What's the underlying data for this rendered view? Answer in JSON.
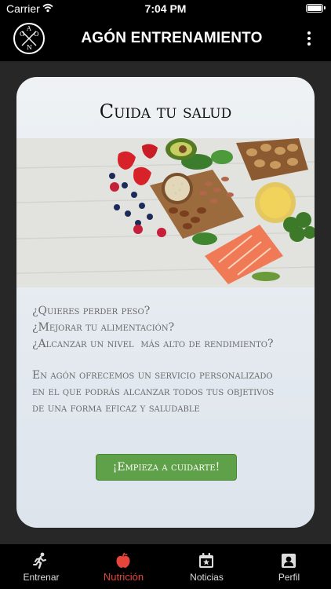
{
  "status_bar": {
    "carrier": "Carrier",
    "time": "7:04 PM"
  },
  "nav": {
    "logo_letters": [
      "G",
      "A",
      "O",
      "N"
    ],
    "title": "AGÓN ENTRENAMIENTO",
    "menu_icon": "more-vertical-icon"
  },
  "card": {
    "title": "Cuida tu salud",
    "image": "healthy-food-photo",
    "questions": [
      "¿Quieres perder peso?",
      "¿Mejorar tu alimentación?",
      "¿Alcanzar un nivel  más alto de rendimiento?"
    ],
    "offer": [
      "En agón ofrecemos un servicio personalizado",
      "en el que podrás alcanzar todos tus objetivos",
      "de una forma eficaz y saludable"
    ],
    "cta_label": "¡Empieza a cuidarte!",
    "cta_color": "#5fa149"
  },
  "tabs": [
    {
      "label": "Entrenar",
      "icon": "running-person-icon",
      "active": false
    },
    {
      "label": "Nutrición",
      "icon": "apple-icon",
      "active": true
    },
    {
      "label": "Noticias",
      "icon": "calendar-star-icon",
      "active": false
    },
    {
      "label": "Perfil",
      "icon": "contact-card-icon",
      "active": false
    }
  ],
  "colors": {
    "active_tab": "#e5453b",
    "background": "#272727"
  }
}
